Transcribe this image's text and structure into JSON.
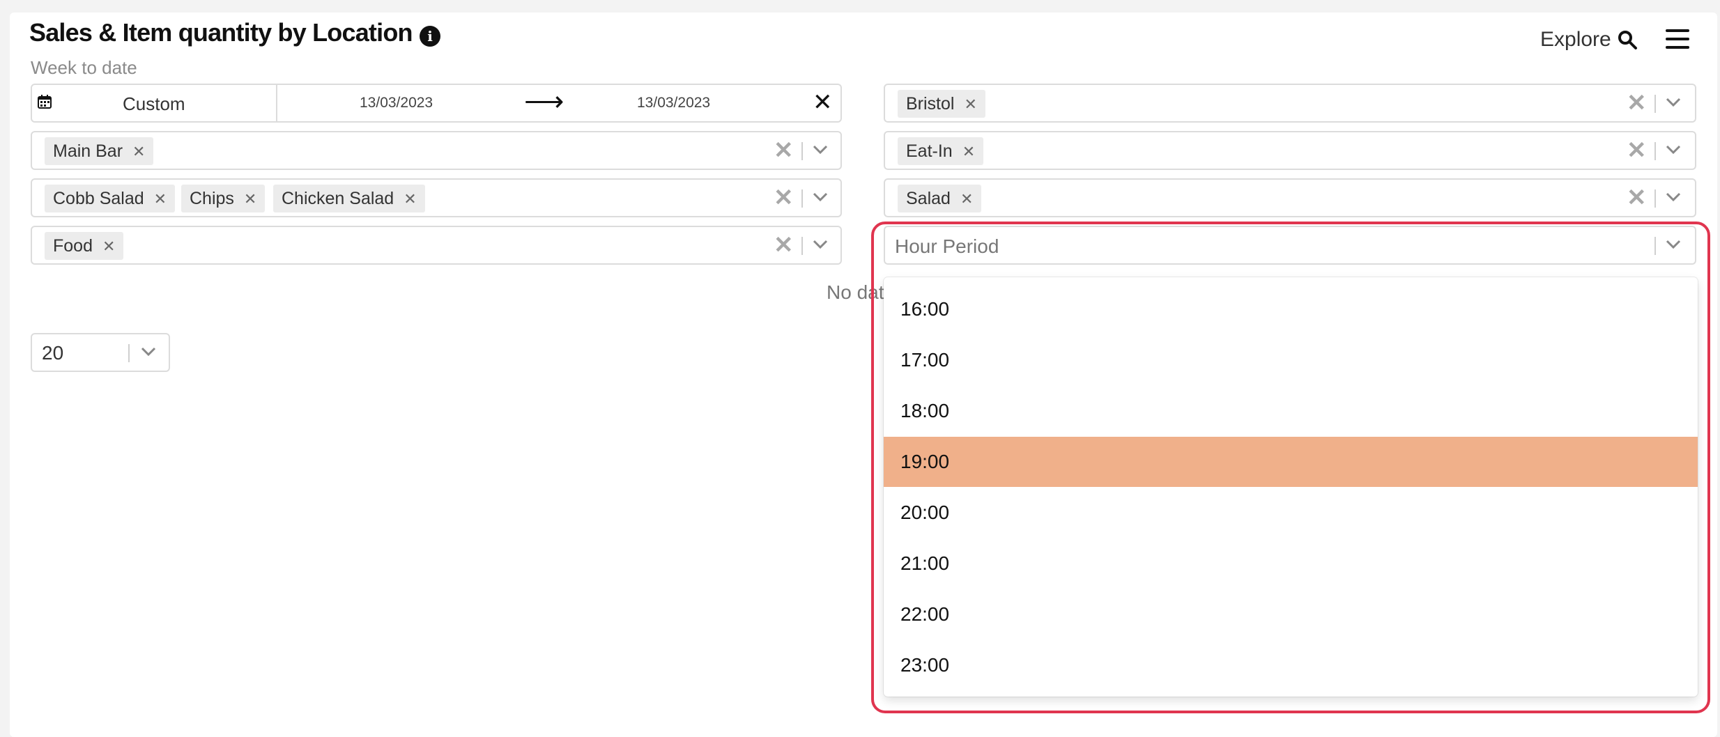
{
  "header": {
    "title": "Sales & Item quantity by Location",
    "subtitle": "Week to date",
    "explore_label": "Explore"
  },
  "icons": {
    "info": "info-icon",
    "explore": "search-icon",
    "menu": "hamburger-menu-icon",
    "calendar": "calendar-icon"
  },
  "date_filter": {
    "preset": "Custom",
    "start": "13/03/2023",
    "arrow": "⟶",
    "end": "13/03/2023",
    "clear": "✕"
  },
  "filters_left": [
    {
      "chips": [
        "Main Bar"
      ]
    },
    {
      "chips": [
        "Cobb Salad",
        "Chips",
        "Chicken Salad"
      ]
    },
    {
      "chips": [
        "Food"
      ]
    }
  ],
  "filters_right": [
    {
      "chips": [
        "Bristol"
      ]
    },
    {
      "chips": [
        "Eat-In"
      ]
    },
    {
      "chips": [
        "Salad"
      ]
    }
  ],
  "hour_period": {
    "placeholder": "Hour Period",
    "options": [
      "16:00",
      "17:00",
      "18:00",
      "19:00",
      "20:00",
      "21:00",
      "22:00",
      "23:00"
    ],
    "highlighted": "19:00"
  },
  "table": {
    "no_data_visible": "No dat"
  },
  "pagination": {
    "page_size": "20"
  },
  "colors": {
    "highlight_border": "#e0354f",
    "option_hover": "#f0b08a"
  },
  "glyphs": {
    "chip_remove": "✕",
    "clear": "✕"
  }
}
